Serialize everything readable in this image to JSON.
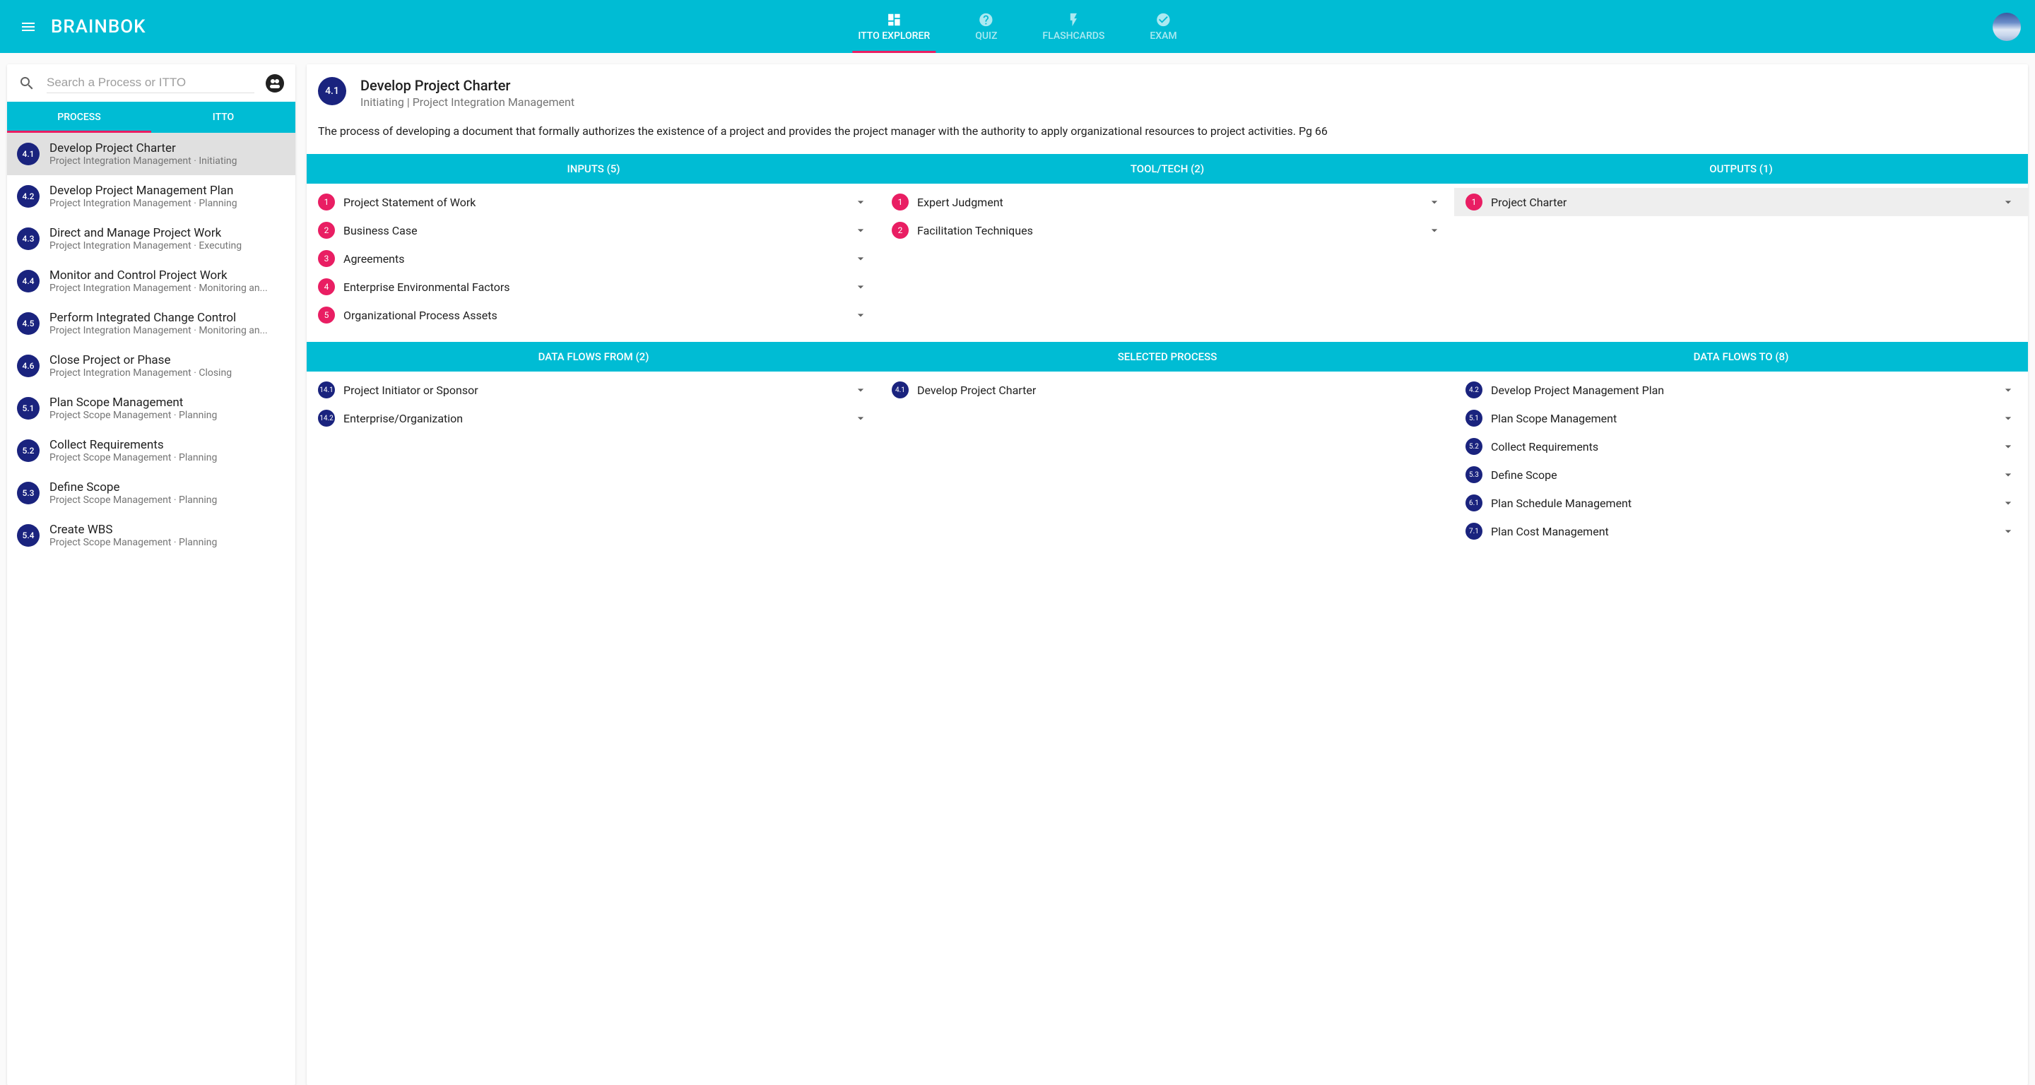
{
  "app": {
    "title": "BRAINBOK"
  },
  "nav": {
    "tabs": [
      {
        "label": "ITTO EXPLORER",
        "icon": "dashboard",
        "active": true
      },
      {
        "label": "QUIZ",
        "icon": "help",
        "active": false
      },
      {
        "label": "FLASHCARDS",
        "icon": "flash",
        "active": false
      },
      {
        "label": "EXAM",
        "icon": "check",
        "active": false
      }
    ]
  },
  "sidebar": {
    "search_placeholder": "Search a Process or ITTO",
    "tabs": [
      {
        "label": "PROCESS",
        "active": true
      },
      {
        "label": "ITTO",
        "active": false
      }
    ],
    "processes": [
      {
        "id": "4.1",
        "name": "Develop Project Charter",
        "sub": "Project Integration Management · Initiating",
        "selected": true
      },
      {
        "id": "4.2",
        "name": "Develop Project Management Plan",
        "sub": "Project Integration Management · Planning",
        "selected": false
      },
      {
        "id": "4.3",
        "name": "Direct and Manage Project Work",
        "sub": "Project Integration Management · Executing",
        "selected": false
      },
      {
        "id": "4.4",
        "name": "Monitor and Control Project Work",
        "sub": "Project Integration Management · Monitoring an...",
        "selected": false
      },
      {
        "id": "4.5",
        "name": "Perform Integrated Change Control",
        "sub": "Project Integration Management · Monitoring an...",
        "selected": false
      },
      {
        "id": "4.6",
        "name": "Close Project or Phase",
        "sub": "Project Integration Management · Closing",
        "selected": false
      },
      {
        "id": "5.1",
        "name": "Plan Scope Management",
        "sub": "Project Scope Management · Planning",
        "selected": false
      },
      {
        "id": "5.2",
        "name": "Collect Requirements",
        "sub": "Project Scope Management · Planning",
        "selected": false
      },
      {
        "id": "5.3",
        "name": "Define Scope",
        "sub": "Project Scope Management · Planning",
        "selected": false
      },
      {
        "id": "5.4",
        "name": "Create WBS",
        "sub": "Project Scope Management · Planning",
        "selected": false
      }
    ]
  },
  "detail": {
    "id": "4.1",
    "title": "Develop Project Charter",
    "subtitle": "Initiating | Project Integration Management",
    "description": "The process of developing a document that formally authorizes the existence of a project and provides the project manager with the authority to apply organizational resources to project activities. Pg 66",
    "sections1": [
      {
        "header": "INPUTS (5)",
        "items": [
          {
            "num": "1",
            "label": "Project Statement of Work",
            "chevron": true,
            "style": "pink"
          },
          {
            "num": "2",
            "label": "Business Case",
            "chevron": true,
            "style": "pink"
          },
          {
            "num": "3",
            "label": "Agreements",
            "chevron": true,
            "style": "pink"
          },
          {
            "num": "4",
            "label": "Enterprise Environmental Factors",
            "chevron": true,
            "style": "pink"
          },
          {
            "num": "5",
            "label": "Organizational Process Assets",
            "chevron": true,
            "style": "pink"
          }
        ]
      },
      {
        "header": "TOOL/TECH (2)",
        "items": [
          {
            "num": "1",
            "label": "Expert Judgment",
            "chevron": true,
            "style": "pink"
          },
          {
            "num": "2",
            "label": "Facilitation Techniques",
            "chevron": true,
            "style": "pink"
          }
        ]
      },
      {
        "header": "OUTPUTS (1)",
        "items": [
          {
            "num": "1",
            "label": "Project Charter",
            "chevron": true,
            "style": "pink",
            "hl": true
          }
        ]
      }
    ],
    "sections2": [
      {
        "header": "DATA FLOWS FROM (2)",
        "items": [
          {
            "num": "14.1",
            "label": "Project Initiator or Sponsor",
            "chevron": true,
            "style": "navy"
          },
          {
            "num": "14.2",
            "label": "Enterprise/Organization",
            "chevron": true,
            "style": "navy"
          }
        ]
      },
      {
        "header": "SELECTED PROCESS",
        "items": [
          {
            "num": "4.1",
            "label": "Develop Project Charter",
            "chevron": false,
            "style": "navy"
          }
        ]
      },
      {
        "header": "DATA FLOWS TO (8)",
        "items": [
          {
            "num": "4.2",
            "label": "Develop Project Management Plan",
            "chevron": true,
            "style": "navy"
          },
          {
            "num": "5.1",
            "label": "Plan Scope Management",
            "chevron": true,
            "style": "navy"
          },
          {
            "num": "5.2",
            "label": "Collect Requirements",
            "chevron": true,
            "style": "navy"
          },
          {
            "num": "5.3",
            "label": "Define Scope",
            "chevron": true,
            "style": "navy"
          },
          {
            "num": "6.1",
            "label": "Plan Schedule Management",
            "chevron": true,
            "style": "navy"
          },
          {
            "num": "7.1",
            "label": "Plan Cost Management",
            "chevron": true,
            "style": "navy"
          }
        ]
      }
    ]
  }
}
